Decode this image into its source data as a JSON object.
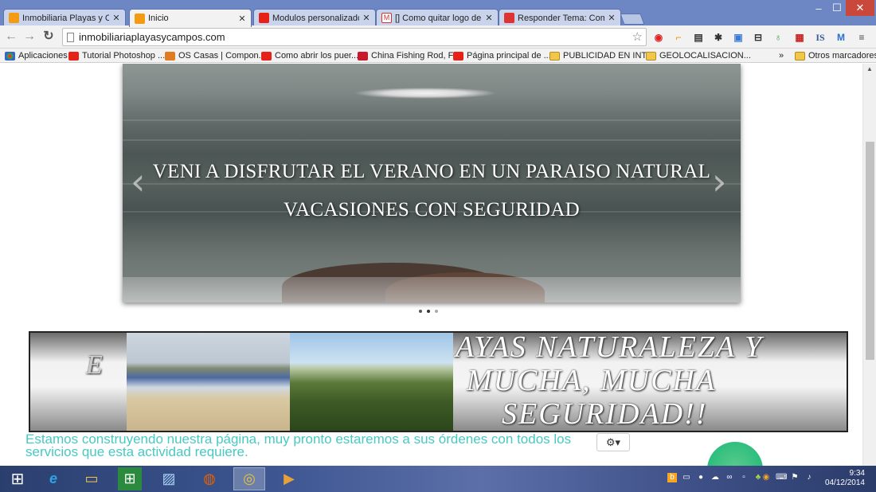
{
  "browser": {
    "tabs": [
      {
        "title": "Inmobiliaria Playas y Cam",
        "icon": "joomla-icon",
        "active": false
      },
      {
        "title": "Inicio",
        "icon": "joomla-icon",
        "active": true
      },
      {
        "title": "Modulos personalizados e",
        "icon": "youtube-icon",
        "active": false
      },
      {
        "title": "[] Como quitar logo de pl",
        "icon": "gmail-icon",
        "active": false
      },
      {
        "title": "Responder Tema: Como q",
        "icon": "forum-icon",
        "active": false
      }
    ],
    "tab_close": "✕",
    "url": "inmobiliariaplayasycampos.com",
    "bookmarks": [
      {
        "label": "Aplicaciones",
        "icon": "apps-icon"
      },
      {
        "label": "Tutorial Photoshop ...",
        "icon": "youtube-icon"
      },
      {
        "label": "OS Casas | Compon...",
        "icon": "os-icon"
      },
      {
        "label": "Como abrir los puer...",
        "icon": "youtube-icon"
      },
      {
        "label": "China Fishing Rod, F...",
        "icon": "mcafee-icon"
      },
      {
        "label": "Página principal de ...",
        "icon": "youtube-icon"
      },
      {
        "label": "PUBLICIDAD EN INT...",
        "icon": "folder-icon"
      },
      {
        "label": "GEOLOCALISACION...",
        "icon": "folder-icon"
      }
    ],
    "bookmarks_more": "»",
    "other_bookmarks": "Otros marcadores"
  },
  "page": {
    "slider": {
      "caption_line1": "VENI A DISFRUTAR EL VERANO EN UN PARAISO NATURAL",
      "caption_line2": "VACASIONES CON SEGURIDAD",
      "prev": "‹",
      "next": "›",
      "slide_count": 3,
      "active_slide": 2
    },
    "banner": {
      "text_left": "E",
      "text_line1": "AYAS NATURALEZA Y",
      "text_line2": "MUCHA, MUCHA",
      "text_line3": "SEGURIDAD!!"
    },
    "notice": "Estamos construyendo nuestra página, muy pronto estaremos a sus órdenes con todos los servicios que esta actividad requiere.",
    "gear_button": "⚙▾"
  },
  "taskbar": {
    "clock_time": "9:34",
    "clock_date": "04/12/2014"
  },
  "colors": {
    "titlebar": "#6d86c4",
    "notice_text": "#48c9c2",
    "taskbar": "#3b5591"
  }
}
